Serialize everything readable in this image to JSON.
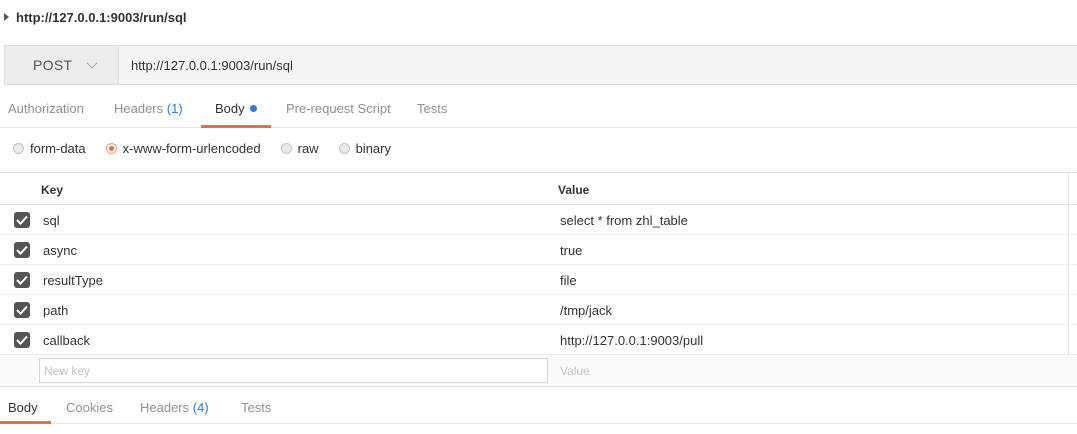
{
  "request": {
    "title": "http://127.0.0.1:9003/run/sql",
    "method": "POST",
    "url": "http://127.0.0.1:9003/run/sql"
  },
  "tabs": {
    "authorization": "Authorization",
    "headers_label": "Headers",
    "headers_count": "(1)",
    "body": "Body",
    "prerequest": "Pre-request Script",
    "tests": "Tests"
  },
  "body_types": {
    "form_data": "form-data",
    "urlencoded": "x-www-form-urlencoded",
    "raw": "raw",
    "binary": "binary",
    "selected": "x-www-form-urlencoded"
  },
  "params": {
    "key_header": "Key",
    "value_header": "Value",
    "rows": [
      {
        "key": "sql",
        "value": "select * from zhl_table",
        "checked": true
      },
      {
        "key": "async",
        "value": "true",
        "checked": true
      },
      {
        "key": "resultType",
        "value": "file",
        "checked": true
      },
      {
        "key": "path",
        "value": "/tmp/jack",
        "checked": true
      },
      {
        "key": "callback",
        "value": "http://127.0.0.1:9003/pull",
        "checked": true
      }
    ],
    "new_key_placeholder": "New key",
    "new_value_placeholder": "Value"
  },
  "response_tabs": {
    "body": "Body",
    "cookies": "Cookies",
    "headers_label": "Headers",
    "headers_count": "(4)",
    "tests": "Tests"
  },
  "colors": {
    "accent": "#f26b3a",
    "link_blue": "#2a7ae2"
  }
}
